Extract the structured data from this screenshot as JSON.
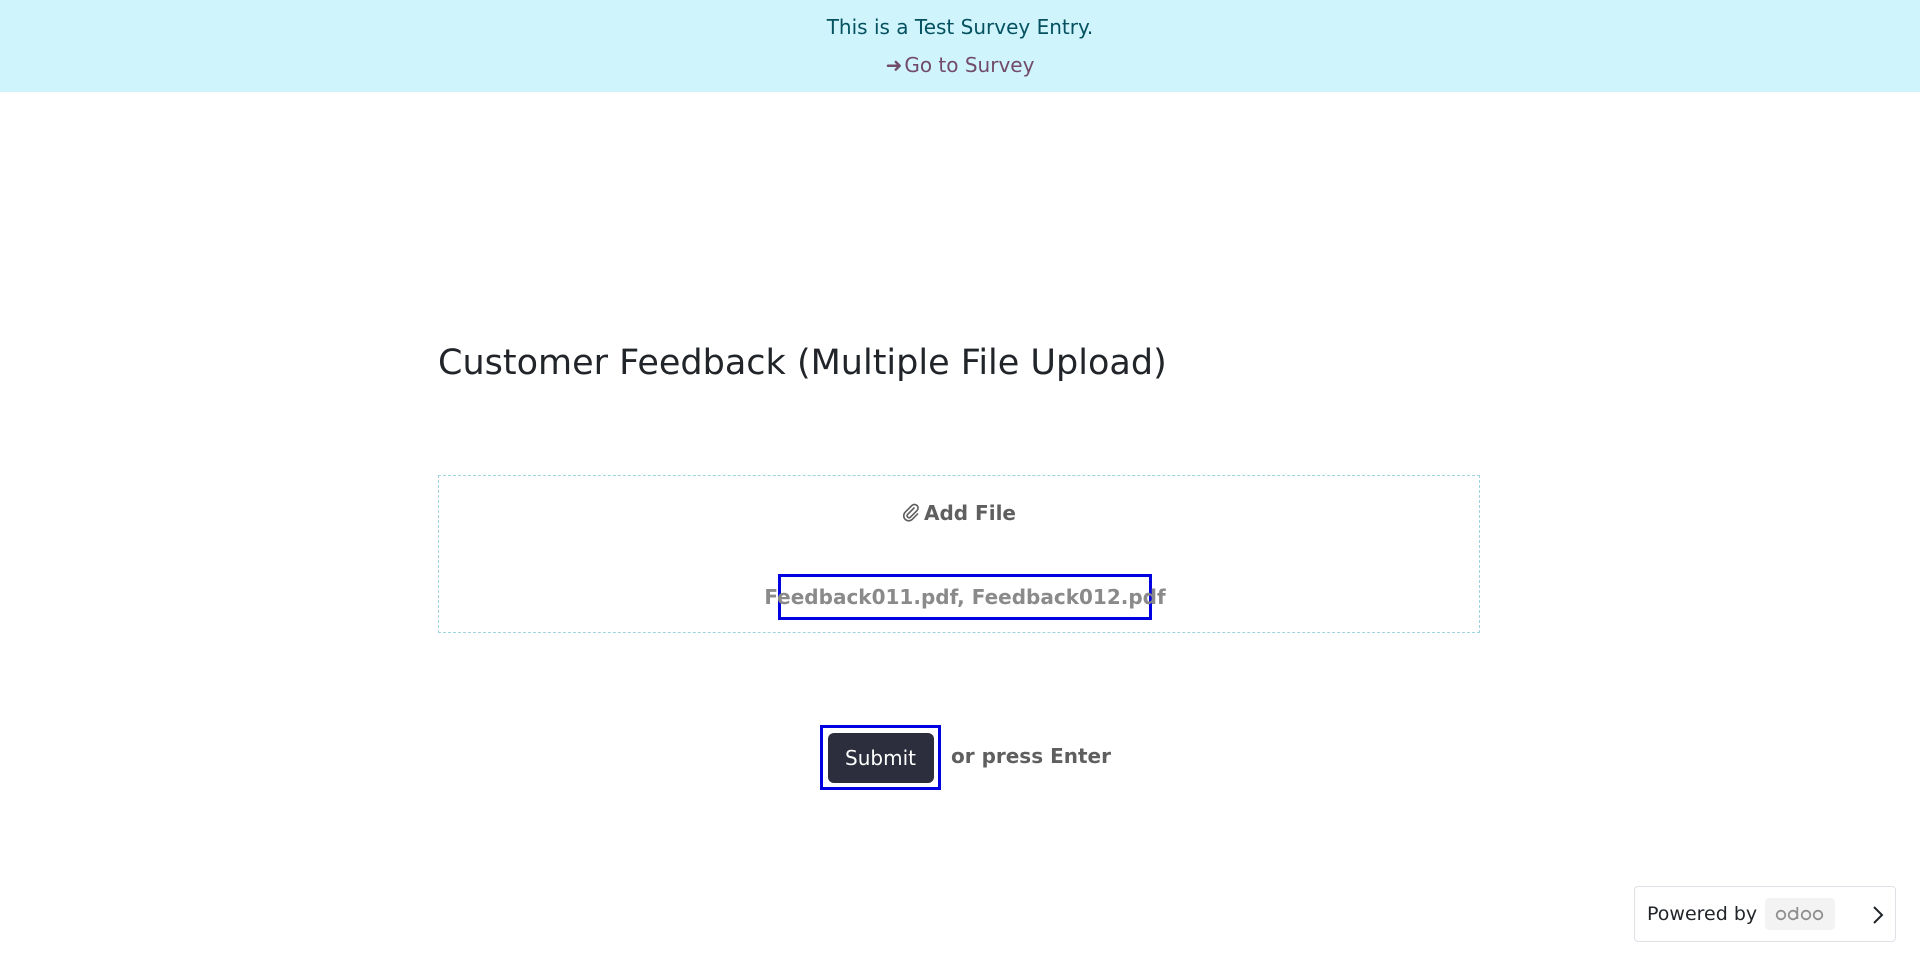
{
  "banner": {
    "message": "This is a Test Survey Entry.",
    "link_label": "Go to Survey",
    "link_icon": "arrow-right-icon"
  },
  "survey": {
    "title": "Customer Feedback (Multiple File Upload)"
  },
  "upload": {
    "add_file_label": "Add File",
    "add_file_icon": "paperclip-icon",
    "file_names": "Feedback011.pdf, Feedback012.pdf"
  },
  "actions": {
    "submit_label": "Submit",
    "press_enter_hint": "or press Enter"
  },
  "footer": {
    "powered_by_label": "Powered by",
    "brand_icon": "odoo-logo",
    "expand_icon": "chevron-right-icon"
  },
  "colors": {
    "banner_bg": "#cff4fc",
    "banner_text": "#055160",
    "link": "#714b67",
    "submit_bg": "#2c2e3e",
    "highlight_border": "#0000e0"
  }
}
